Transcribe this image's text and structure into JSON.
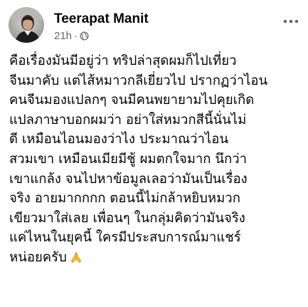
{
  "post": {
    "author": "Teerapat Manit",
    "time": "21h",
    "separator": "·",
    "audience_icon": "globe-icon",
    "menu_icon": "more-options-icon",
    "lines": [
      "คือเรื่องมันมีอยู่ว่า ทริปล่าสุดผมก็ไปเที่ยว",
      "จีนมาคับ แต่ไส้หมาวกลีเยี่ยวไป ปรากฏว่าไอน",
      "คนจีนมองแปลกๆ จนมีคนพยายามไปคุยเกิด",
      "แปลภาษาบอกผมว่า อย่าใส่หมวกสีนี้นั่นไม่",
      "ดี เหมือนไอนมองว่าไง ประมาณว่าไอน",
      "สวมเขา เหมือนเมียมีชู้ ผมตกใจมาก นึกว่า",
      "เขาแกล้ง จนไปหาข้อมูลเลอว่ามันเป็นเรื่อง",
      "จริง อายมากกกก ตอนนี้ไม่กล้าหยิบหมวก",
      "เขียวมาใส่เลย เพื่อนๆ ในกลุ่มคิดว่ามันจริง",
      "แค่ไหนในยุคนี้ ใครมีประสบการณ์มาแชร์",
      "หน่อยครับ"
    ],
    "trailing_emoji_icon": "folded-hands-icon"
  }
}
